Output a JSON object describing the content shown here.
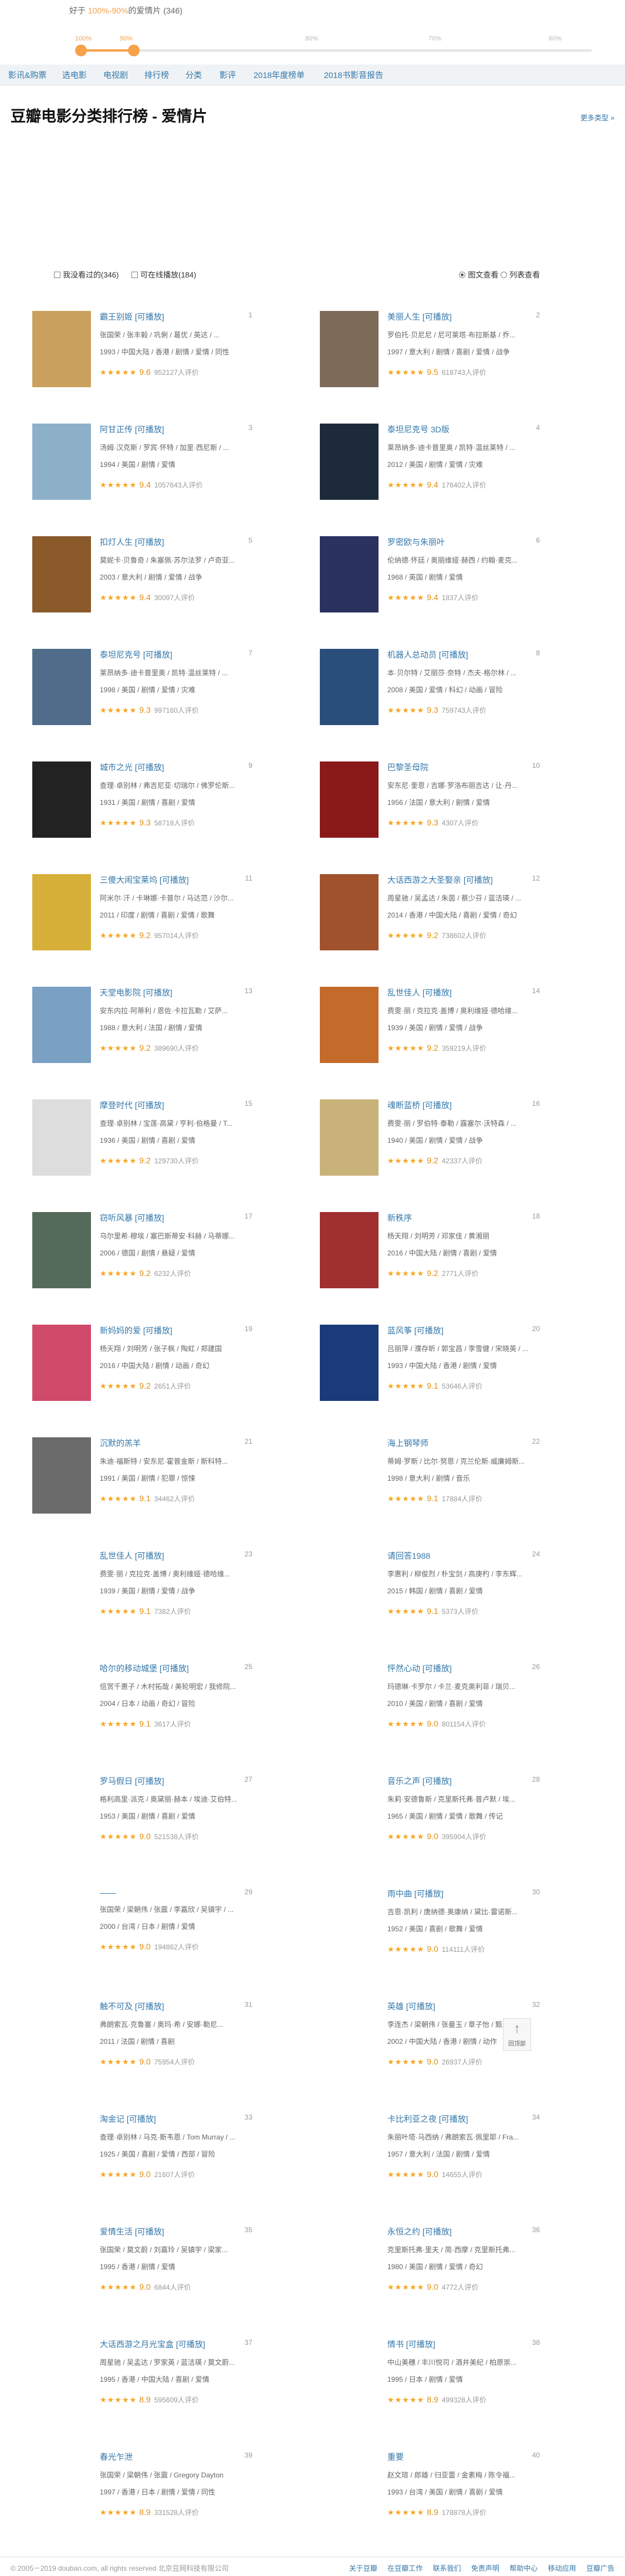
{
  "range": {
    "prefix": "好于",
    "value": "100%-90%",
    "suffix": "的爱情片 (346)"
  },
  "slider_ticks": [
    "100%",
    "90%",
    "80%",
    "70%",
    "60%"
  ],
  "nav": [
    "影讯&购票",
    "选电影",
    "电视剧",
    "排行榜",
    "分类",
    "影评",
    "2018年度榜单",
    "2018书影音报告"
  ],
  "page": {
    "title": "豆瓣电影分类排行榜 - 爱情片",
    "more": "更多类型 »"
  },
  "filters": {
    "watched": "我没看过的(346)",
    "playable": "可在线播放(184)"
  },
  "view": {
    "grid": "图文查看",
    "list": "列表查看"
  },
  "movies": [
    {
      "rank": "1",
      "title": "霸王别姬",
      "tag": "[可播放]",
      "l1": "张国荣 / 张丰毅 / 巩俐 / 葛优 / 英达 / ...",
      "l2": "1993 / 中国大陆 / 香港 / 剧情 / 爱情 / 同性",
      "score": "9.6",
      "count": "952127人评价",
      "c": "#c9a15c"
    },
    {
      "rank": "2",
      "title": "美丽人生",
      "tag": "[可播放]",
      "l1": "罗伯托·贝尼尼 / 尼可莱塔·布拉斯基 / 乔...",
      "l2": "1997 / 意大利 / 剧情 / 喜剧 / 爱情 / 战争",
      "score": "9.5",
      "count": "618743人评价",
      "c": "#7d6b5a"
    },
    {
      "rank": "3",
      "title": "阿甘正传",
      "tag": "[可播放]",
      "l1": "汤姆·汉克斯 / 罗宾·怀特 / 加里·西尼斯 / ...",
      "l2": "1994 / 美国 / 剧情 / 爱情",
      "score": "9.4",
      "count": "1057643人评价",
      "c": "#8db0c9"
    },
    {
      "rank": "4",
      "title": "泰坦尼克号",
      "tag": "3D版",
      "l1": "莱昂纳多·迪卡普里奥 / 凯特·温丝莱特 / ...",
      "l2": "2012 / 美国 / 剧情 / 爱情 / 灾难",
      "score": "9.4",
      "count": "176402人评价",
      "c": "#1d2a3a"
    },
    {
      "rank": "5",
      "title": "扣灯人生",
      "tag": "[可播放]",
      "l1": "莫妮卡·贝鲁奇 / 朱塞佩·苏尔法罗 / 卢奇亚...",
      "l2": "2003 / 意大利 / 剧情 / 爱情 / 战争",
      "score": "9.4",
      "count": "30097人评价",
      "c": "#8a5a2b"
    },
    {
      "rank": "6",
      "title": "罗密欧与朱丽叶",
      "tag": "",
      "l1": "伦纳德·怀廷 / 奥丽维娅·赫西 / 约翰·麦克...",
      "l2": "1968 / 英国 / 剧情 / 爱情",
      "score": "9.4",
      "count": "1837人评价",
      "c": "#2b3260"
    },
    {
      "rank": "7",
      "title": "泰坦尼克号",
      "tag": "[可播放]",
      "l1": "莱昂纳多·迪卡普里奥 / 凯特·温丝莱特 / ...",
      "l2": "1998 / 美国 / 剧情 / 爱情 / 灾难",
      "score": "9.3",
      "count": "997160人评价",
      "c": "#4f6d8a"
    },
    {
      "rank": "8",
      "title": "机器人总动员",
      "tag": "[可播放]",
      "l1": "本·贝尔特 / 艾丽莎·奈特 / 杰夫·格尔林 / ...",
      "l2": "2008 / 美国 / 爱情 / 科幻 / 动画 / 冒险",
      "score": "9.3",
      "count": "759743人评价",
      "c": "#2a4e7a"
    },
    {
      "rank": "9",
      "title": "城市之光",
      "tag": "[可播放]",
      "l1": "查理·卓别林 / 弗吉尼亚·切瑞尔 / 佛罗伦斯...",
      "l2": "1931 / 美国 / 剧情 / 喜剧 / 爱情",
      "score": "9.3",
      "count": "58718人评价",
      "c": "#222"
    },
    {
      "rank": "10",
      "title": "巴黎圣母院",
      "tag": "",
      "l1": "安东尼·奎恩 / 吉娜·罗洛布丽吉达 / 让·丹...",
      "l2": "1956 / 法国 / 意大利 / 剧情 / 爱情",
      "score": "9.3",
      "count": "4307人评价",
      "c": "#8a1a1a"
    },
    {
      "rank": "11",
      "title": "三傻大闹宝莱坞",
      "tag": "[可播放]",
      "l1": "阿米尔·汗 / 卡琳娜·卡普尔 / 马达范 / 沙尔...",
      "l2": "2011 / 印度 / 剧情 / 喜剧 / 爱情 / 歌舞",
      "score": "9.2",
      "count": "957014人评价",
      "c": "#d7b03a"
    },
    {
      "rank": "12",
      "title": "大话西游之大圣娶亲",
      "tag": "[可播放]",
      "l1": "周星驰 / 吴孟达 / 朱茵 / 蔡少芬 / 蓝洁瑛 / ...",
      "l2": "2014 / 香港 / 中国大陆 / 喜剧 / 爱情 / 奇幻",
      "score": "9.2",
      "count": "738602人评价",
      "c": "#a0522d"
    },
    {
      "rank": "13",
      "title": "天堂电影院",
      "tag": "[可播放]",
      "l1": "安东内拉·阿蒂利 / 恩佐·卡拉瓦勒 / 艾萨...",
      "l2": "1988 / 意大利 / 法国 / 剧情 / 爱情",
      "score": "9.2",
      "count": "389690人评价",
      "c": "#7aa0c4"
    },
    {
      "rank": "14",
      "title": "乱世佳人",
      "tag": "[可播放]",
      "l1": "费雯·丽 / 克拉克·盖博 / 奥利维娅·德哈维...",
      "l2": "1939 / 美国 / 剧情 / 爱情 / 战争",
      "score": "9.2",
      "count": "359219人评价",
      "c": "#c46a2a"
    },
    {
      "rank": "15",
      "title": "摩登时代",
      "tag": "[可播放]",
      "l1": "查理·卓别林 / 宝莲·高黛 / 亨利·伯格曼 / T...",
      "l2": "1936 / 美国 / 剧情 / 喜剧 / 爱情",
      "score": "9.2",
      "count": "129730人评价",
      "c": "#ddd"
    },
    {
      "rank": "16",
      "title": "魂断蓝桥",
      "tag": "[可播放]",
      "l1": "费雯·丽 / 罗伯特·泰勒 / 露塞尔·沃特森 / ...",
      "l2": "1940 / 美国 / 剧情 / 爱情 / 战争",
      "score": "9.2",
      "count": "42337人评价",
      "c": "#c9b27a"
    },
    {
      "rank": "17",
      "title": "窃听风暴",
      "tag": "[可播放]",
      "l1": "乌尔里希·穆埃 / 塞巴斯蒂安·科赫 / 马蒂娜...",
      "l2": "2006 / 德国 / 剧情 / 悬疑 / 爱情",
      "score": "9.2",
      "count": "6232人评价",
      "c": "#556b5a"
    },
    {
      "rank": "18",
      "title": "新秩序",
      "tag": "",
      "l1": "杨天翔 / 刘明芳 / 邓家佳 / 黄湘丽",
      "l2": "2016 / 中国大陆 / 剧情 / 喜剧 / 爱情",
      "score": "9.2",
      "count": "2771人评价",
      "c": "#a03030"
    },
    {
      "rank": "19",
      "title": "新妈妈的爱",
      "tag": "[可播放]",
      "l1": "杨天翔 / 刘明芳 / 张子枫 / 陶虹 / 郑建国",
      "l2": "2016 / 中国大陆 / 剧情 / 动画 / 奇幻",
      "score": "9.2",
      "count": "2651人评价",
      "c": "#d04a6a"
    },
    {
      "rank": "20",
      "title": "蓝风筝",
      "tag": "[可播放]",
      "l1": "吕丽萍 / 濮存昕 / 郭宝昌 / 李雪健 / 宋晓英 / ...",
      "l2": "1993 / 中国大陆 / 香港 / 剧情 / 爱情",
      "score": "9.1",
      "count": "53646人评价",
      "c": "#1a3a7a"
    },
    {
      "rank": "21",
      "title": "沉默的羔羊",
      "tag": "",
      "l1": "朱迪·福斯特 / 安东尼·霍普金斯 / 斯科特...",
      "l2": "1991 / 美国 / 剧情 / 犯罪 / 惊悚",
      "score": "9.1",
      "count": "34462人评价",
      "c": "#6b6b6b"
    },
    {
      "rank": "22",
      "title": "海上钢琴师",
      "tag": "",
      "l1": "蒂姆·罗斯 / 比尔·努恩 / 克兰伦斯·威廉姆斯...",
      "l2": "1998 / 意大利 / 剧情 / 音乐",
      "score": "9.1",
      "count": "17884人评价",
      "c": ""
    },
    {
      "rank": "23",
      "title": "乱世佳人",
      "tag": "[可播放]",
      "l1": "费雯·丽 / 克拉克·盖博 / 奥利维娅·德哈维...",
      "l2": "1939 / 美国 / 剧情 / 爱情 / 战争",
      "score": "9.1",
      "count": "7382人评价",
      "c": ""
    },
    {
      "rank": "24",
      "title": "请回答1988",
      "tag": "",
      "l1": "李惠利 / 柳俊烈 / 朴宝剑 / 高庚杓 / 李东辉...",
      "l2": "2015 / 韩国 / 剧情 / 喜剧 / 爱情",
      "score": "9.1",
      "count": "5373人评价",
      "c": ""
    },
    {
      "rank": "25",
      "title": "哈尔的移动城堡",
      "tag": "[可播放]",
      "l1": "倍赏千惠子 / 木村拓哉 / 美轮明宏 / 我修院...",
      "l2": "2004 / 日本 / 动画 / 奇幻 / 冒险",
      "score": "9.1",
      "count": "3617人评价",
      "c": ""
    },
    {
      "rank": "26",
      "title": "怦然心动",
      "tag": "[可播放]",
      "l1": "玛德琳·卡罗尔 / 卡兰·麦克奥利菲 / 瑞贝...",
      "l2": "2010 / 美国 / 剧情 / 喜剧 / 爱情",
      "score": "9.0",
      "count": "801154人评价",
      "c": ""
    },
    {
      "rank": "27",
      "title": "罗马假日",
      "tag": "[可播放]",
      "l1": "格利高里·派克 / 奥黛丽·赫本 / 埃迪·艾伯特...",
      "l2": "1953 / 美国 / 剧情 / 喜剧 / 爱情",
      "score": "9.0",
      "count": "521538人评价",
      "c": ""
    },
    {
      "rank": "28",
      "title": "音乐之声",
      "tag": "[可播放]",
      "l1": "朱莉·安德鲁斯 / 克里斯托弗·普卢默 / 埃...",
      "l2": "1965 / 美国 / 剧情 / 爱情 / 歌舞 / 传记",
      "score": "9.0",
      "count": "395904人评价",
      "c": ""
    },
    {
      "rank": "29",
      "title": "——",
      "tag": "",
      "l1": "张国荣 / 梁朝伟 / 张震 / 李嘉欣 / 吴镇宇 / ...",
      "l2": "2000 / 台湾 / 日本 / 剧情 / 爱情",
      "score": "9.0",
      "count": "194862人评价",
      "c": ""
    },
    {
      "rank": "30",
      "title": "雨中曲",
      "tag": "[可播放]",
      "l1": "吉恩·凯利 / 唐纳德·奥康纳 / 黛比·雷诺斯...",
      "l2": "1952 / 美国 / 喜剧 / 歌舞 / 爱情",
      "score": "9.0",
      "count": "114111人评价",
      "c": ""
    },
    {
      "rank": "31",
      "title": "触不可及",
      "tag": "[可播放]",
      "l1": "弗朗索瓦·克鲁塞 / 奥玛·希 / 安娜·勒尼...",
      "l2": "2011 / 法国 / 剧情 / 喜剧",
      "score": "9.0",
      "count": "75954人评价",
      "c": ""
    },
    {
      "rank": "32",
      "title": "英雄",
      "tag": "[可播放]",
      "l1": "李连杰 / 梁朝伟 / 张曼玉 / 章子怡 / 甄子丹...",
      "l2": "2002 / 中国大陆 / 香港 / 剧情 / 动作",
      "score": "9.0",
      "count": "26937人评价",
      "c": ""
    },
    {
      "rank": "33",
      "title": "淘金记",
      "tag": "[可播放]",
      "l1": "查理·卓别林 / 马克·斯韦恩 / Tom Murray / ...",
      "l2": "1925 / 美国 / 喜剧 / 爱情 / 西部 / 冒险",
      "score": "9.0",
      "count": "21607人评价",
      "c": ""
    },
    {
      "rank": "34",
      "title": "卡比利亚之夜",
      "tag": "[可播放]",
      "l1": "朱丽叶塔·马西纳 / 弗朗索瓦·佩里耶 / Fra...",
      "l2": "1957 / 意大利 / 法国 / 剧情 / 爱情",
      "score": "9.0",
      "count": "14655人评价",
      "c": ""
    },
    {
      "rank": "35",
      "title": "爱情生活",
      "tag": "[可播放]",
      "l1": "张国荣 / 莫文蔚 / 刘嘉玲 / 吴镇宇 / 梁家...",
      "l2": "1995 / 香港 / 剧情 / 爱情",
      "score": "9.0",
      "count": "6844人评价",
      "c": ""
    },
    {
      "rank": "36",
      "title": "永恒之约",
      "tag": "[可播放]",
      "l1": "克里斯托弗·里夫 / 简·西摩 / 克里斯托弗...",
      "l2": "1980 / 美国 / 剧情 / 爱情 / 奇幻",
      "score": "9.0",
      "count": "4772人评价",
      "c": ""
    },
    {
      "rank": "37",
      "title": "大话西游之月光宝盒",
      "tag": "[可播放]",
      "l1": "周星驰 / 吴孟达 / 罗家英 / 蓝洁瑛 / 莫文蔚...",
      "l2": "1995 / 香港 / 中国大陆 / 喜剧 / 爱情",
      "score": "8.9",
      "count": "595609人评价",
      "c": ""
    },
    {
      "rank": "38",
      "title": "情书",
      "tag": "[可播放]",
      "l1": "中山美穗 / 丰川悦司 / 酒井美纪 / 柏原崇...",
      "l2": "1995 / 日本 / 剧情 / 爱情",
      "score": "8.9",
      "count": "499328人评价",
      "c": ""
    },
    {
      "rank": "39",
      "title": "春光乍泄",
      "tag": "",
      "l1": "张国荣 / 梁朝伟 / 张震 / Gregory Dayton",
      "l2": "1997 / 香港 / 日本 / 剧情 / 爱情 / 同性",
      "score": "8.9",
      "count": "331528人评价",
      "c": ""
    },
    {
      "rank": "40",
      "title": "重要",
      "tag": "",
      "l1": "赵文瑄 / 郎雄 / 归亚蕾 / 金素梅 / 陈令福...",
      "l2": "1993 / 台湾 / 美国 / 剧情 / 喜剧 / 爱情",
      "score": "8.9",
      "count": "178878人评价",
      "c": ""
    }
  ],
  "back_top": "回顶部",
  "footer": {
    "copy": "© 2005－2019 douban.com, all rights reserved 北京豆网科技有限公司",
    "links": [
      "关于豆瓣",
      "在豆瓣工作",
      "联系我们",
      "免责声明",
      "帮助中心",
      "移动应用",
      "豆瓣广告"
    ]
  }
}
